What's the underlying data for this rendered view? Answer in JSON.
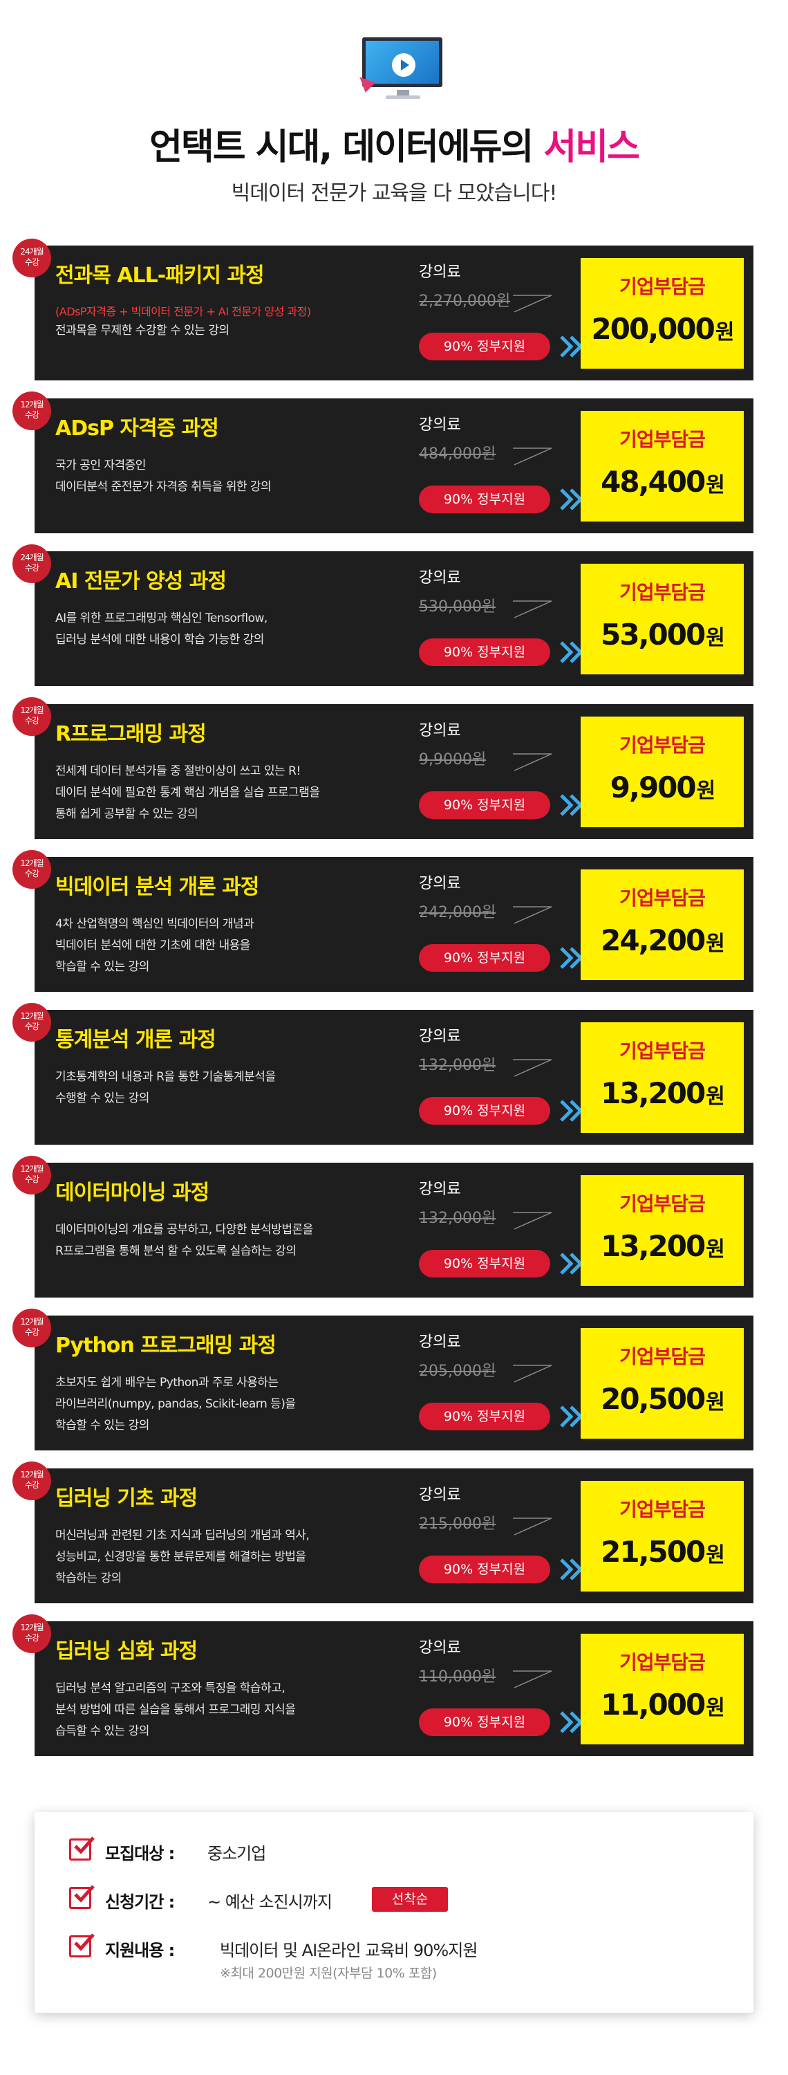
{
  "header": {
    "title_main": "언택트 시대, 데이터에듀의 ",
    "title_accent": "서비스",
    "subtitle": "빅데이터 전문가 교육을 다 모았습니다!"
  },
  "labels": {
    "fee": "강의료",
    "gov_support": "90% 정부지원",
    "company_cost": "기업부담금",
    "won": "원"
  },
  "courses": [
    {
      "badge_months": "24개월",
      "badge_suffix": "수강",
      "title": "전과목 ALL-패키지 과정",
      "highlight": "(ADsP자격증 + 빅데이터 전문가 + AI 전문가 양성 과정)",
      "desc": [
        "전과목을 무제한 수강할 수 있는 강의"
      ],
      "original_price": "2,270,000원",
      "price": "200,000"
    },
    {
      "badge_months": "12개월",
      "badge_suffix": "수강",
      "title": "ADsP 자격증 과정",
      "highlight": "",
      "desc": [
        "국가 공인 자격증인",
        "데이터분석 준전문가 자격증 취득을 위한 강의"
      ],
      "original_price": "484,000원",
      "price": "48,400"
    },
    {
      "badge_months": "24개월",
      "badge_suffix": "수강",
      "title": "AI 전문가 양성 과정",
      "highlight": "",
      "desc": [
        "AI를 위한 프로그래밍과 핵심인 Tensorflow,",
        "딥러닝 분석에 대한 내용이 학습 가능한 강의"
      ],
      "original_price": "530,000원",
      "price": "53,000"
    },
    {
      "badge_months": "12개월",
      "badge_suffix": "수강",
      "title": "R프로그래밍 과정",
      "highlight": "",
      "desc": [
        "전세계 데이터 분석가들 중 절반이상이 쓰고 있는 R!",
        "데이터 분석에 필요한 통계 핵심 개념을 실습 프로그램을",
        "통해 쉽게 공부할 수 있는 강의"
      ],
      "original_price": "9,9000원",
      "price": "9,900"
    },
    {
      "badge_months": "12개월",
      "badge_suffix": "수강",
      "title": "빅데이터 분석 개론 과정",
      "highlight": "",
      "desc": [
        "4차 산업혁명의 핵심인 빅데이터의 개념과",
        "빅데이터 분석에 대한 기초에 대한 내용을",
        "학습할 수 있는 강의"
      ],
      "original_price": "242,000원",
      "price": "24,200"
    },
    {
      "badge_months": "12개월",
      "badge_suffix": "수강",
      "title": "통계분석 개론 과정",
      "highlight": "",
      "desc": [
        "기초통계학의 내용과 R을 통한 기술통계분석을",
        "수행할 수 있는 강의"
      ],
      "original_price": "132,000원",
      "price": "13,200"
    },
    {
      "badge_months": "12개월",
      "badge_suffix": "수강",
      "title": "데이터마이닝 과정",
      "highlight": "",
      "desc": [
        "데이터마이닝의 개요를 공부하고, 다양한 분석방법론을",
        "R프로그램을 통해 분석 할 수 있도록 실습하는 강의"
      ],
      "original_price": "132,000원",
      "price": "13,200"
    },
    {
      "badge_months": "12개월",
      "badge_suffix": "수강",
      "title": "Python 프로그래밍 과정",
      "highlight": "",
      "desc": [
        "초보자도 쉽게 배우는 Python과 주로 사용하는",
        "라이브러리(numpy, pandas, Scikit-learn 등)을",
        "학습할 수 있는 강의"
      ],
      "original_price": "205,000원",
      "price": "20,500"
    },
    {
      "badge_months": "12개월",
      "badge_suffix": "수강",
      "title": "딥러닝 기초 과정",
      "highlight": "",
      "desc": [
        "머신러닝과 관련된 기초 지식과 딥러닝의 개념과 역사,",
        "성능비교, 신경망을 통한 분류문제를 해결하는 방법을",
        "학습하는 강의"
      ],
      "original_price": "215,000원",
      "price": "21,500"
    },
    {
      "badge_months": "12개월",
      "badge_suffix": "수강",
      "title": "딥러닝 심화 과정",
      "highlight": "",
      "desc": [
        "딥러닝 분석 알고리즘의 구조와 특징을 학습하고,",
        "분석 방법에 따른 실습을 통해서 프로그래밍 지식을",
        "습득할 수 있는 강의"
      ],
      "original_price": "110,000원",
      "price": "11,000"
    }
  ],
  "info": {
    "target_label": "모집대상 :",
    "target_value": "중소기업",
    "period_label": "신청기간 :",
    "period_value": "~ 예산 소진시까지",
    "period_tag": "선착순",
    "support_label": "지원내용 :",
    "support_value": "빅데이터 및 AI온라인 교육비 90%지원",
    "support_note": "※최대 200만원 지원(자부담 10% 포함)"
  },
  "colors": {
    "accent_pink": "#e8117f",
    "card_bg": "#1e1e1e",
    "title_yellow": "#ffe600",
    "price_box": "#fff100",
    "red": "#d8192f",
    "chevron_blue": "#3fa9e8"
  },
  "icons": [
    "monitor-play-icon",
    "chevron-right-icon",
    "checkbox-checked-icon"
  ]
}
